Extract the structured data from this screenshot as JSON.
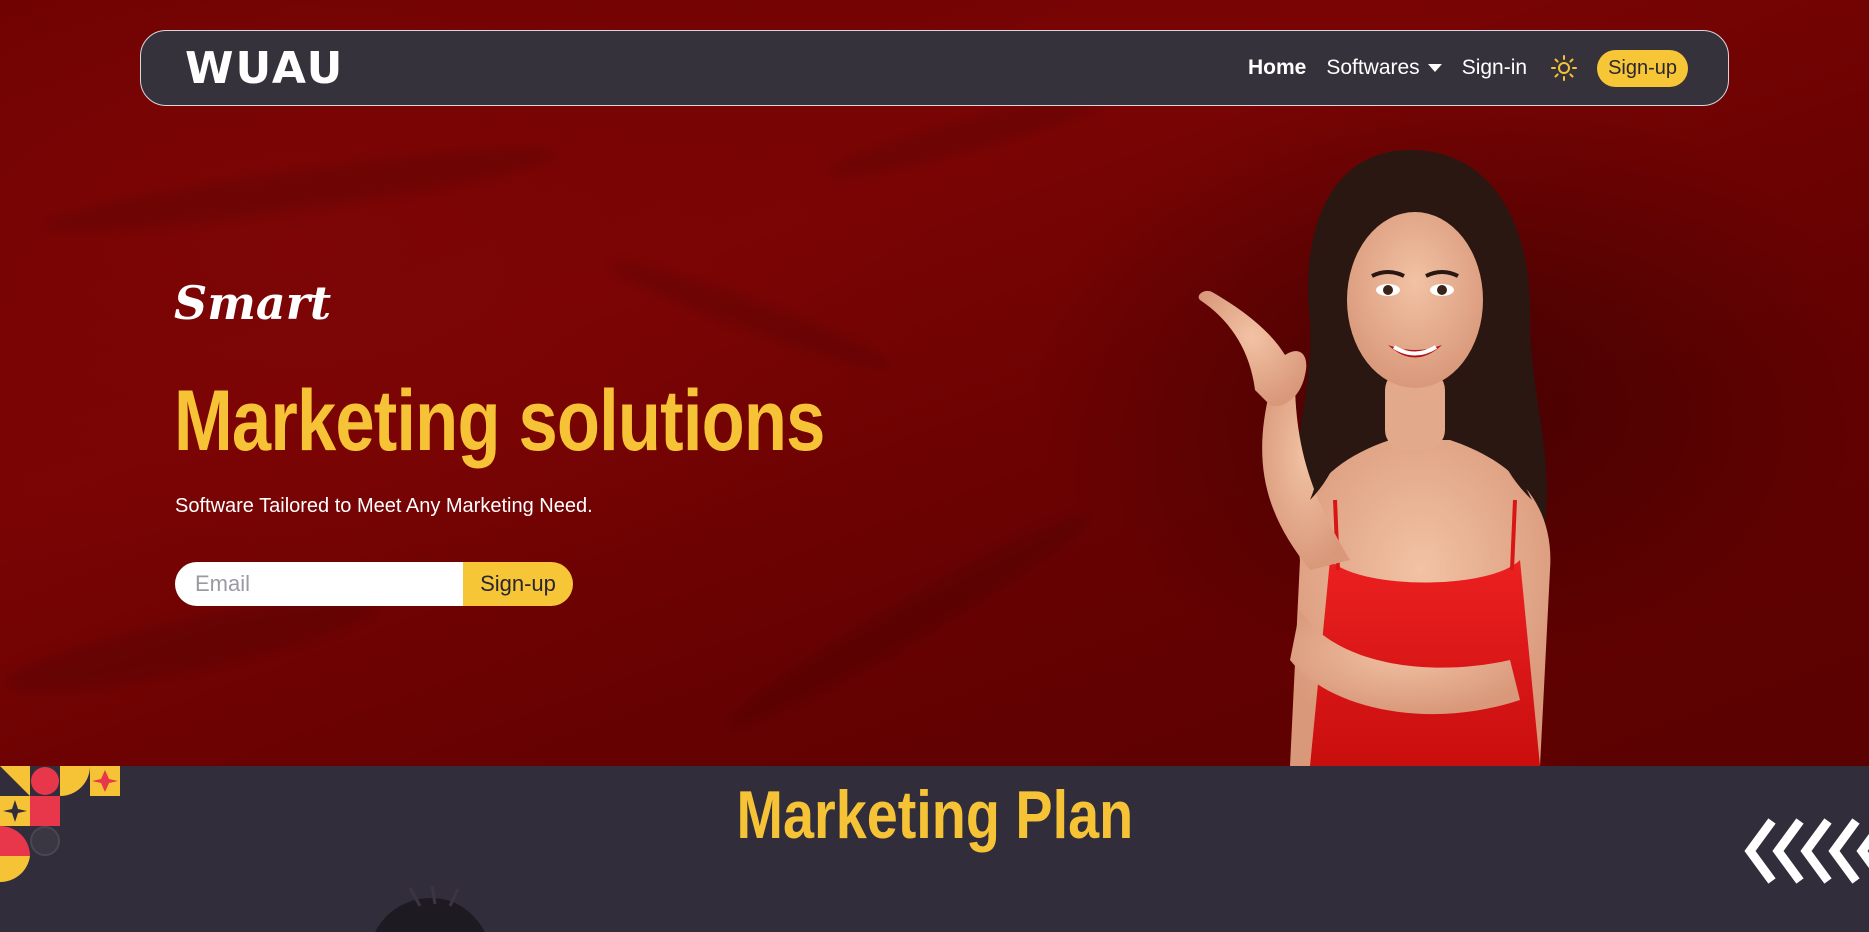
{
  "nav": {
    "logo": "WUAU",
    "home": "Home",
    "softwares": "Softwares",
    "signin": "Sign-in",
    "signup": "Sign-up"
  },
  "hero": {
    "kicker": "Smart",
    "headline": "Marketing solutions",
    "subtitle": "Software Tailored to Meet Any Marketing Need.",
    "email_placeholder": "Email",
    "signup_button": "Sign-up"
  },
  "section": {
    "title": "Marketing Plan"
  },
  "colors": {
    "accent": "#f6c336",
    "hero_red": "#6e0202",
    "dark": "#312d3a"
  },
  "icons": [
    "sun-icon",
    "chevron-down-icon",
    "chevrons-left-icon"
  ]
}
